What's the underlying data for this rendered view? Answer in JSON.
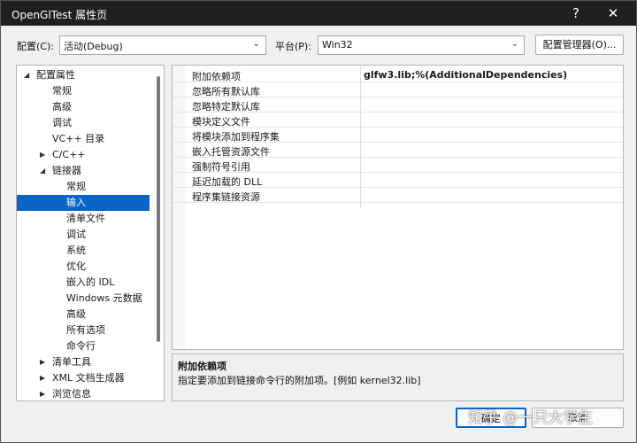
{
  "window": {
    "title": "OpenGlTest 属性页",
    "help_glyph": "?",
    "close_glyph": "✕"
  },
  "config": {
    "config_label": "配置(C):",
    "config_value": "活动(Debug)",
    "platform_label": "平台(P):",
    "platform_value": "Win32",
    "manager_button": "配置管理器(O)..."
  },
  "tree": {
    "items": [
      {
        "label": "配置属性",
        "level": 0,
        "state": "expanded"
      },
      {
        "label": "常规",
        "level": 1,
        "state": "leaf"
      },
      {
        "label": "高级",
        "level": 1,
        "state": "leaf"
      },
      {
        "label": "调试",
        "level": 1,
        "state": "leaf"
      },
      {
        "label": "VC++ 目录",
        "level": 1,
        "state": "leaf"
      },
      {
        "label": "C/C++",
        "level": 1,
        "state": "collapsed"
      },
      {
        "label": "链接器",
        "level": 1,
        "state": "expanded"
      },
      {
        "label": "常规",
        "level": 2,
        "state": "leaf"
      },
      {
        "label": "输入",
        "level": 2,
        "state": "leaf",
        "selected": true
      },
      {
        "label": "清单文件",
        "level": 2,
        "state": "leaf"
      },
      {
        "label": "调试",
        "level": 2,
        "state": "leaf"
      },
      {
        "label": "系统",
        "level": 2,
        "state": "leaf"
      },
      {
        "label": "优化",
        "level": 2,
        "state": "leaf"
      },
      {
        "label": "嵌入的 IDL",
        "level": 2,
        "state": "leaf"
      },
      {
        "label": "Windows 元数据",
        "level": 2,
        "state": "leaf"
      },
      {
        "label": "高级",
        "level": 2,
        "state": "leaf"
      },
      {
        "label": "所有选项",
        "level": 2,
        "state": "leaf"
      },
      {
        "label": "命令行",
        "level": 2,
        "state": "leaf"
      },
      {
        "label": "清单工具",
        "level": 1,
        "state": "collapsed"
      },
      {
        "label": "XML 文档生成器",
        "level": 1,
        "state": "collapsed"
      },
      {
        "label": "浏览信息",
        "level": 1,
        "state": "collapsed"
      }
    ]
  },
  "properties": [
    {
      "name": "附加依赖项",
      "value": "glfw3.lib;%(AdditionalDependencies)",
      "selected": true
    },
    {
      "name": "忽略所有默认库",
      "value": ""
    },
    {
      "name": "忽略特定默认库",
      "value": ""
    },
    {
      "name": "模块定义文件",
      "value": ""
    },
    {
      "name": "将模块添加到程序集",
      "value": ""
    },
    {
      "name": "嵌入托管资源文件",
      "value": ""
    },
    {
      "name": "强制符号引用",
      "value": ""
    },
    {
      "name": "延迟加载的 DLL",
      "value": ""
    },
    {
      "name": "程序集链接资源",
      "value": ""
    }
  ],
  "description": {
    "title": "附加依赖项",
    "text": "指定要添加到链接命令行的附加项。[例如 kernel32.lib]"
  },
  "buttons": {
    "ok": "确定",
    "cancel": "取消"
  },
  "watermark": "知乎 @一只大学生",
  "colors": {
    "accent": "#0a64c8",
    "titlebar": "#1f1f1f"
  }
}
